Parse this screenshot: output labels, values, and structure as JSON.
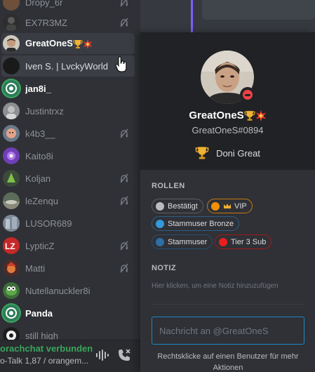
{
  "members": [
    {
      "name": "Dropy_6r",
      "icon": "deafen-icon",
      "state": "normal"
    },
    {
      "name": "EX7R3MZ",
      "icon": "deafen-icon",
      "state": "normal"
    },
    {
      "name": "GreatOneS",
      "icon": "",
      "state": "selected"
    },
    {
      "name": "Iven S. | LvckyWorld",
      "icon": "",
      "state": "hover"
    },
    {
      "name": "jan8i_",
      "icon": "",
      "state": "bright"
    },
    {
      "name": "Justintrxz",
      "icon": "",
      "state": "normal"
    },
    {
      "name": "k4b3__",
      "icon": "deafen-icon",
      "state": "normal"
    },
    {
      "name": "Kaito8i",
      "icon": "",
      "state": "normal"
    },
    {
      "name": "Koljan",
      "icon": "deafen-icon",
      "state": "normal"
    },
    {
      "name": "leZenqu",
      "icon": "deafen-icon",
      "state": "normal"
    },
    {
      "name": "LUSOR689",
      "icon": "",
      "state": "normal"
    },
    {
      "name": "LypticZ",
      "icon": "deafen-icon",
      "state": "normal"
    },
    {
      "name": "Matti",
      "icon": "deafen-icon",
      "state": "normal"
    },
    {
      "name": "Nutellanuckler8i",
      "icon": "",
      "state": "normal"
    },
    {
      "name": "Panda",
      "icon": "",
      "state": "bright"
    },
    {
      "name": "still high",
      "icon": "",
      "state": "normal"
    }
  ],
  "voice_footer": {
    "status": "orachchat verbunden",
    "channel": "o-Talk 1,87 / orangem..."
  },
  "profile": {
    "display_name": "GreatOneS",
    "tag": "GreatOneS#0894",
    "status": "dnd",
    "activity": "Doni Great",
    "roles_title": "ROLLEN",
    "roles": [
      {
        "label": "Bestätigt",
        "color": "#b9bbbe",
        "crown": false
      },
      {
        "label": "VIP",
        "color": "#f0900b",
        "crown": true
      },
      {
        "label": "Stammuser Bronze",
        "color": "#3498db",
        "crown": false
      },
      {
        "label": "Stammuser",
        "color": "#2d6fa6",
        "crown": false
      },
      {
        "label": "Tier 3 Sub",
        "color": "#e91e1e",
        "crown": false
      }
    ],
    "note_title": "NOTIZ",
    "note_placeholder": "Hier klicken, um eine Notiz hinzuzufügen",
    "message_placeholder": "Nachricht an @GreatOneS",
    "hint": "Rechtsklicke auf einen Benutzer für mehr Aktionen"
  },
  "colors": {
    "accent_blue": "#1e86c8",
    "connected_green": "#3ba55c",
    "dnd_red": "#ed4245",
    "trophy_gold": "#f0b232",
    "collision_red": "#e8362a"
  }
}
